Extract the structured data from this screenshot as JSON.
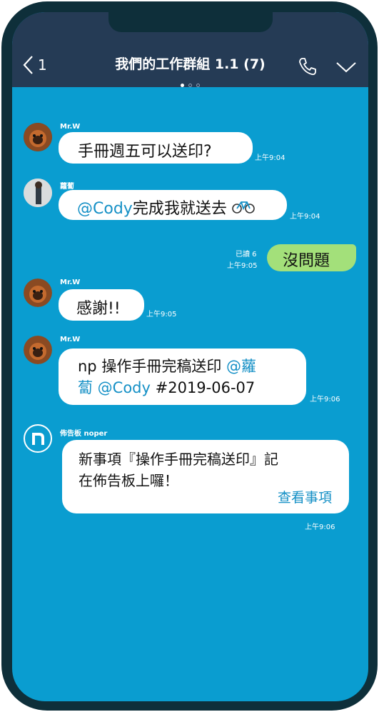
{
  "header": {
    "back_count": "1",
    "title": "我們的工作群組 1.1 (7)"
  },
  "messages": [
    {
      "sender": "Mr.W",
      "text": "手冊週五可以送印?",
      "time": "上午9:04"
    },
    {
      "sender": "蘿蔔",
      "mention": "@Cody",
      "text": "完成我就送去",
      "emoji": "bicycle",
      "time": "上午9:04"
    },
    {
      "read": "已讀 6",
      "time": "上午9:05",
      "text": "沒問題"
    },
    {
      "sender": "Mr.W",
      "text": "感謝!!",
      "time": "上午9:05"
    },
    {
      "sender": "Mr.W",
      "line1_text": "np 操作手冊完稿送印 ",
      "line1_mention": "@蘿",
      "line2_mention": "蔔 @Cody",
      "line2_text": " #2019-06-07",
      "time": "上午9:06"
    },
    {
      "sender": "佈告板 noper",
      "line1": "新事項『操作手冊完稿送印』記",
      "line2": "在佈告板上囉！",
      "link": "查看事項",
      "time": "上午9:06"
    }
  ],
  "colors": {
    "chat_bg": "#0a9dd0",
    "header_bg": "#253b55",
    "frame": "#0e2f3a",
    "own_bubble": "#a3e07a",
    "mention": "#1590c6"
  },
  "icons": [
    "back-chevron-icon",
    "phone-icon",
    "chevron-down-icon",
    "bicycle-icon",
    "noper-logo-icon"
  ]
}
